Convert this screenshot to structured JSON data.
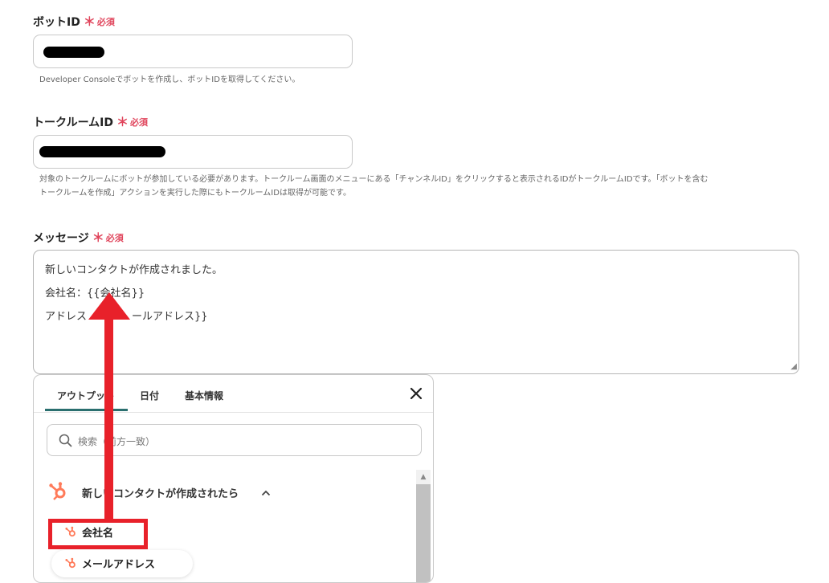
{
  "fields": {
    "bot_id": {
      "label": "ボットID",
      "required_mark": "＊",
      "required_text": "必須",
      "help": "Developer Consoleでボットを作成し、ボットIDを取得してください。"
    },
    "talk_room_id": {
      "label": "トークルームID",
      "required_mark": "＊",
      "required_text": "必須",
      "help_line1": "対象のトークルームにボットが参加している必要があります。トークルーム画面のメニューにある「チャンネルID」をクリックすると表示されるIDがトークルームIDです。「ボットを含む",
      "help_line2": "トークルームを作成」アクションを実行した際にもトークルームIDは取得が可能です。"
    },
    "message": {
      "label": "メッセージ",
      "required_mark": "＊",
      "required_text": "必須",
      "line1": "新しいコンタクトが作成されました。",
      "line2": "会社名：{{会社名}}",
      "line3_start": "アドレス",
      "line3_end": "ールアドレス}}"
    }
  },
  "picker": {
    "tabs": [
      "アウトプット",
      "日付",
      "基本情報"
    ],
    "active_tab": 0,
    "search_placeholder": "検索（前方一致）",
    "group_title": "新しいコンタクトが作成されたら",
    "items": [
      "会社名",
      "メールアドレス"
    ]
  },
  "colors": {
    "required": "#e0455c",
    "tab_underline": "#2a6f6f",
    "annotation_red": "#e8212a",
    "hubspot_orange": "#ff7a59"
  },
  "icons": {
    "search": "search-icon",
    "close": "close-icon",
    "hubspot": "hubspot-icon",
    "chevron": "chevron-up-icon"
  }
}
